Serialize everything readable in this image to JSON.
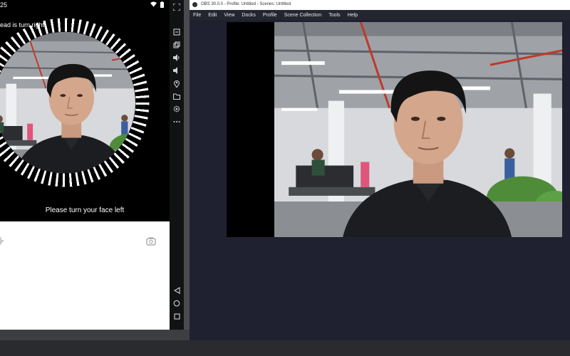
{
  "phone": {
    "status_time": "25",
    "prompt_top": "ead is turn right",
    "prompt_bottom": "Please turn your face left"
  },
  "emulator_toolbar": {
    "icons": [
      "fullscreen-icon",
      "screenshot-icon",
      "window-icon",
      "volume-up-icon",
      "volume-down-icon",
      "location-icon",
      "folder-icon",
      "settings-icon",
      "more-icon",
      "back-icon",
      "home-icon",
      "recents-icon"
    ]
  },
  "obs": {
    "title": "OBS 30.0.0 - Profile: Untitled - Scenes: Untitled",
    "menu": [
      "File",
      "Edit",
      "View",
      "Docks",
      "Profile",
      "Scene Collection",
      "Tools",
      "Help"
    ]
  },
  "colors": {
    "obs_background": "#1f2130",
    "emulator_toolbar": "#111214",
    "phone_panel": "#ffffff"
  }
}
